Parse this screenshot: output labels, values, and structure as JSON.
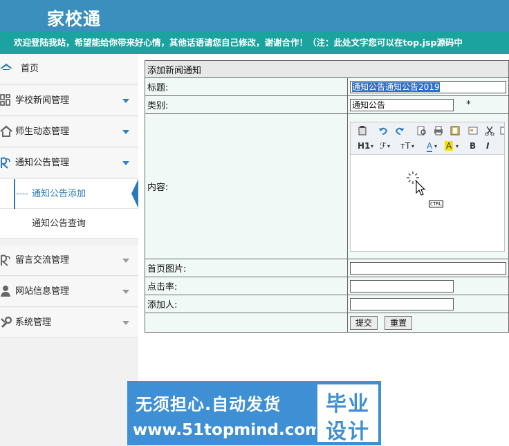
{
  "header": {
    "title": "家校通"
  },
  "notice": {
    "text": "欢迎登陆我站，希望能给你带来好心情，其他话语请您自己修改，谢谢合作！（注：此处文字您可以在top.jsp源码中"
  },
  "sidebar": {
    "home": "首页",
    "items": [
      {
        "label": "学校新闻管理"
      },
      {
        "label": "师生动态管理"
      },
      {
        "label": "通知公告管理"
      },
      {
        "label": "留言交流管理"
      },
      {
        "label": "网站信息管理"
      },
      {
        "label": "系统管理"
      }
    ],
    "subitems": [
      {
        "label": "通知公告添加"
      },
      {
        "label": "通知公告查询"
      }
    ]
  },
  "form": {
    "heading": "添加新闻通知",
    "title_label": "标题:",
    "title_value": "通知公告通知公告2019",
    "category_label": "类别:",
    "category_value": "通知公告",
    "required_mark": "*",
    "content_label": "内容:",
    "image_label": "首页图片:",
    "clicks_label": "点击率:",
    "adder_label": "添加人:",
    "submit_label": "提交",
    "reset_label": "重置"
  },
  "editor": {
    "h1": "H1",
    "font": "ℱ",
    "size": "ᴛT",
    "font_color": "A",
    "bg_color": "A",
    "bold": "B",
    "italic": "I",
    "ctrl_hint": "CTRL"
  },
  "watermark": {
    "line1": "无须担心.自动发货",
    "line2": "www.51topmind.com",
    "badge1": "毕业",
    "badge2": "设计"
  }
}
